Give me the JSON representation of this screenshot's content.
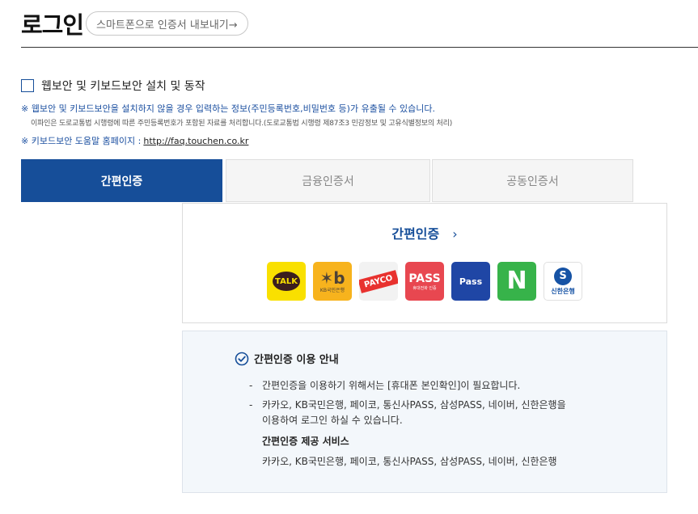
{
  "header": {
    "title": "로그인",
    "export_button": "스마트폰으로 인증서 내보내기→"
  },
  "security": {
    "checkbox_label": "웹보안 및 키보드보안 설치 및 동작",
    "notice_main": "※ 웹보안 및 키보드보안을 설치하지 않을 경우 입력하는 정보(주민등록번호,비밀번호 등)가 유출될 수 있습니다.",
    "notice_sub": "이파인은 도로교통법 시행령에 따른 주민등록번호가 포함된 자료를 처리합니다.(도로교통법 시행령 제87조3 민감정보 및 고유식별정보의 처리)",
    "helpdesk_label": "※ 키보드보안 도움말 홈페이지 :",
    "helpdesk_link": "http://faq.touchen.co.kr"
  },
  "tabs": [
    {
      "label": "간편인증",
      "active": true
    },
    {
      "label": "금융인증서",
      "active": false
    },
    {
      "label": "공동인증서",
      "active": false
    }
  ],
  "simple_auth": {
    "title": "간편인증",
    "chevron": "›",
    "providers": [
      {
        "icon": "kakaotalk-icon",
        "text": "TALK",
        "color": "#f9e000"
      },
      {
        "icon": "kb-bank-icon",
        "text": "KB국민은행",
        "color": "#f7b31d"
      },
      {
        "icon": "payco-icon",
        "text": "PAYCO",
        "color": "#e8322f"
      },
      {
        "icon": "pass-carrier-icon",
        "text": "PASS",
        "sub": "휴대전화 인증",
        "color": "#e84750"
      },
      {
        "icon": "samsung-pass-icon",
        "text": "Pass",
        "color": "#1f46a5"
      },
      {
        "icon": "naver-icon",
        "text": "N",
        "color": "#37b34a"
      },
      {
        "icon": "shinhan-bank-icon",
        "text": "신한은행",
        "color": "#1653a5"
      }
    ]
  },
  "guide": {
    "title": "간편인증 이용 안내",
    "bullet1": "간편인증을 이용하기 위해서는 [휴대폰 본인확인]이 필요합니다.",
    "bullet2": "카카오, KB국민은행, 페이코, 통신사PASS, 삼성PASS, 네이버, 신한은행을",
    "bullet2_cont": "이용하여 로그인 하실 수 있습니다.",
    "service_title": "간편인증 제공 서비스",
    "service_list": "카카오, KB국민은행, 페이코, 통신사PASS, 삼성PASS, 네이버, 신한은행"
  }
}
